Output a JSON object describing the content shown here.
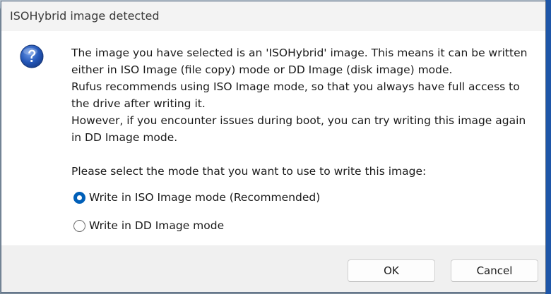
{
  "dialog": {
    "title": "ISOHybrid image detected",
    "icon": "question-icon",
    "message_lines": [
      "The image you have selected is an 'ISOHybrid' image. This means it can be written either in ISO Image (file copy) mode or DD Image (disk image) mode.",
      "Rufus recommends using ISO Image mode, so that you always have full access to the drive after writing it.",
      "However, if you encounter issues during boot, you can try writing this image again in DD Image mode."
    ],
    "prompt": "Please select the mode that you want to use to write this image:",
    "options": [
      {
        "label": "Write in ISO Image mode (Recommended)",
        "selected": true
      },
      {
        "label": "Write in DD Image mode",
        "selected": false
      }
    ],
    "buttons": {
      "ok": "OK",
      "cancel": "Cancel"
    }
  },
  "colors": {
    "accent": "#005fb8",
    "icon_blue": "#2457b8",
    "footer_bg": "#f0f0f0",
    "titlebar_bg": "#f3f3f3"
  }
}
